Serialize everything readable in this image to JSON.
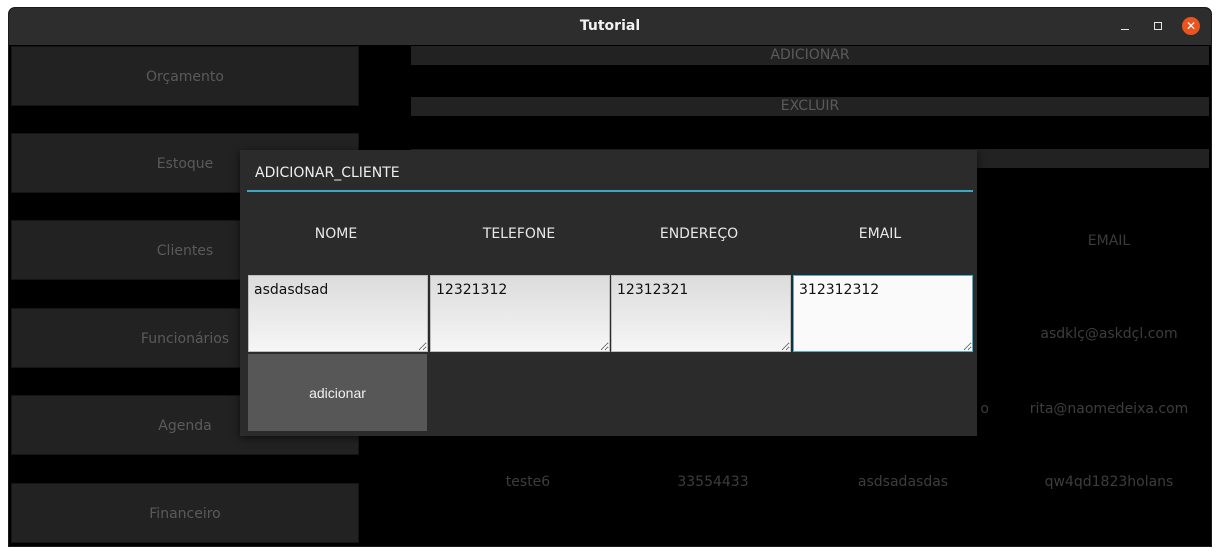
{
  "window": {
    "title": "Tutorial"
  },
  "controls": {
    "close_glyph": "✕"
  },
  "sidebar": {
    "items": [
      "Orçamento",
      "Estoque",
      "Clientes",
      "Funcionários",
      "Agenda",
      "Financeiro"
    ]
  },
  "toolbar": {
    "add": "ADICIONAR",
    "delete": "EXCLUIR"
  },
  "table": {
    "email_header": "EMAIL",
    "rows": [
      {
        "email": "asdklç@askdçl.com"
      },
      {
        "address_partial": "o",
        "email": "rita@naomedeixa.com"
      },
      {
        "name": "teste6",
        "phone": "33554433",
        "address": "asdsadasdas",
        "email": "qw4qd1823holans"
      }
    ]
  },
  "dialog": {
    "title": "ADICIONAR_CLIENTE",
    "columns": [
      "NOME",
      "TELEFONE",
      "ENDEREÇO",
      "EMAIL"
    ],
    "values": {
      "nome": "asdasdsad",
      "telefone": "12321312",
      "endereco": "12312321",
      "email": "312312312"
    },
    "add_button": "adicionar"
  }
}
